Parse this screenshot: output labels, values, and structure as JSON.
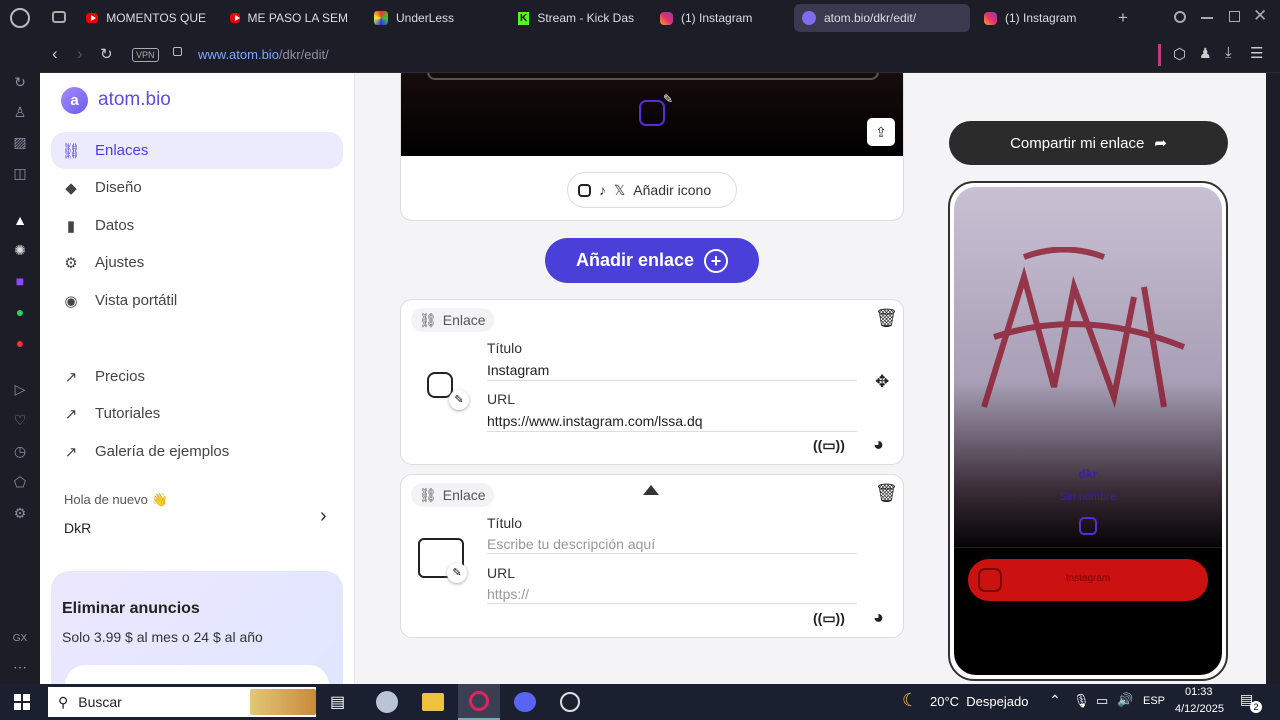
{
  "browser": {
    "tabs": [
      {
        "title": "MOMENTOS QUE",
        "icon": "youtube-icon"
      },
      {
        "title": "ME PASO LA SEM",
        "icon": "youtube-icon"
      },
      {
        "title": "UnderLess",
        "icon": "underless-icon"
      },
      {
        "title": "Stream - Kick Das",
        "icon": "kick-icon"
      },
      {
        "title": "(1) Instagram",
        "icon": "instagram-icon"
      },
      {
        "title": "atom.bio/dkr/edit/",
        "icon": "atom-icon"
      },
      {
        "title": "(1) Instagram",
        "icon": "instagram-icon"
      }
    ],
    "new_tab": "+",
    "vpn": "VPN",
    "url_host": "www.atom.bio",
    "url_path": "/dkr/edit/"
  },
  "sidebar": {
    "brand": "atom.bio",
    "nav": [
      {
        "label": "Enlaces",
        "icon": "link-icon"
      },
      {
        "label": "Diseño",
        "icon": "paint-bucket-icon"
      },
      {
        "label": "Datos",
        "icon": "bar-chart-icon"
      },
      {
        "label": "Ajustes",
        "icon": "gear-icon"
      },
      {
        "label": "Vista portátil",
        "icon": "eye-icon"
      }
    ],
    "ext": [
      {
        "label": "Precios"
      },
      {
        "label": "Tutoriales"
      },
      {
        "label": "Galería de ejemplos"
      }
    ],
    "greeting": "Hola de nuevo",
    "username": "DkR",
    "promo": {
      "title": "Eliminar anuncios",
      "text": "Solo 3.99 $ al mes o 24 $ al año"
    }
  },
  "main": {
    "add_icon_label": "Añadir icono",
    "add_link_button": "Añadir enlace",
    "links": [
      {
        "type": "Enlace",
        "title_label": "Título",
        "title_value": "Instagram",
        "url_label": "URL",
        "url_value": "https://www.instagram.com/lssa.dq"
      },
      {
        "type": "Enlace",
        "title_label": "Título",
        "title_placeholder": "Escribe tu descripción aquí",
        "url_label": "URL",
        "url_placeholder": "https://"
      }
    ]
  },
  "preview": {
    "share_button": "Compartir mi enlace",
    "handle": "dkr",
    "bio": "Sin nombre",
    "link_label": "Instagram"
  },
  "taskbar": {
    "search": "Buscar",
    "weather": "20°C  Despejado",
    "lang": "ESP",
    "time": "01:33",
    "date": "4/12/2025",
    "notif": "2"
  },
  "colors": {
    "accent": "#4a3fd8",
    "share_bg": "#2b2b2b",
    "preview_link": "#c11"
  }
}
